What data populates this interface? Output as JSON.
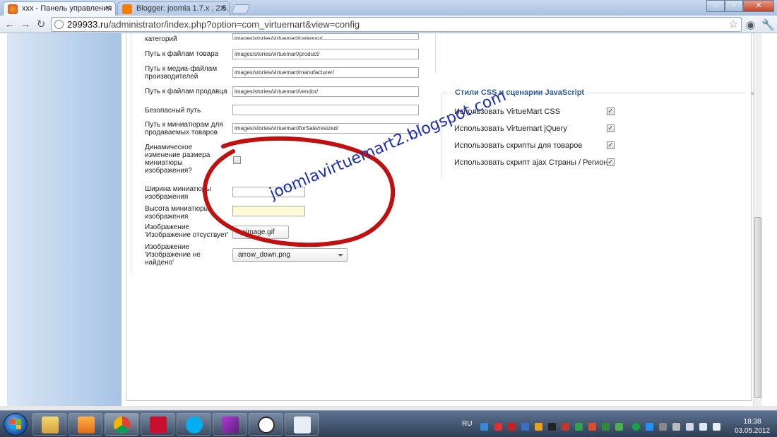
{
  "browser": {
    "tabs": [
      {
        "title": "xxx - Панель управления",
        "icon_color": "#e57b23"
      },
      {
        "title": "Blogger: joomla 1.7.x , 2.5.x",
        "icon_color": "#f57d00"
      }
    ],
    "address": {
      "host": "299933.ru",
      "path": "/administrator/index.php?option=com_virtuemart&view=config"
    },
    "icons": {
      "back": "back-arrow-icon",
      "forward": "forward-arrow-icon",
      "reload": "reload-icon",
      "star": "star-icon",
      "wrench": "wrench-icon",
      "chrome": "chrome-logo-icon"
    }
  },
  "form": {
    "rows": [
      {
        "label": "категорий",
        "value": "images/stories/virtuemart/category/"
      },
      {
        "label": "Путь к файлам товара",
        "value": "images/stories/virtuemart/product/"
      },
      {
        "label": "Путь к медиа-файлам производителей",
        "value": "images/stories/virtuemart/manufacturer/"
      },
      {
        "label": "Путь к файлам продавца",
        "value": "images/stories/virtuemart/vendor/"
      },
      {
        "label": "Безопасный путь",
        "value": ""
      },
      {
        "label": "Путь к миниатюрам для продаваемых товаров",
        "value": "images/stories/virtuemart/forSale/resized/"
      }
    ],
    "dynamic_resize": {
      "label": "Динамическое изменение размера миниатюры изображения?",
      "checked": false
    },
    "thumb_width": {
      "label": "Ширина миниатюры изображения",
      "value": ""
    },
    "thumb_height": {
      "label": "Высота миниатюры изображения",
      "value": ""
    },
    "no_image": {
      "label": "Изображение 'Изображение отсуствует'",
      "value": "noimage.gif"
    },
    "not_found": {
      "label": "Изображение 'Изображение не найдено'",
      "value": "arrow_down.png"
    }
  },
  "css_js": {
    "legend": "Стили CSS и сценарии JavaScript",
    "items": [
      {
        "label": "Использовать VirtueMart CSS",
        "checked": true
      },
      {
        "label": "Использовать Virtuemart jQuery",
        "checked": true
      },
      {
        "label": "Использовать скрипты для товаров",
        "checked": true
      },
      {
        "label": "Использовать скрипт ajax Страны / Регионы",
        "checked": true
      }
    ]
  },
  "watermark": {
    "text": "joomlavirtuemart2.blogspot.com",
    "color": "#1b2db0"
  },
  "annotation": {
    "color": "#c01010"
  },
  "taskbar": {
    "language": "RU",
    "time": "18:38",
    "date": "03.05.2012",
    "apps": [
      "explorer-icon",
      "media-player-icon",
      "chrome-icon",
      "acrobat-icon",
      "skype-icon",
      "feather-icon",
      "info-icon",
      "document-icon"
    ]
  }
}
